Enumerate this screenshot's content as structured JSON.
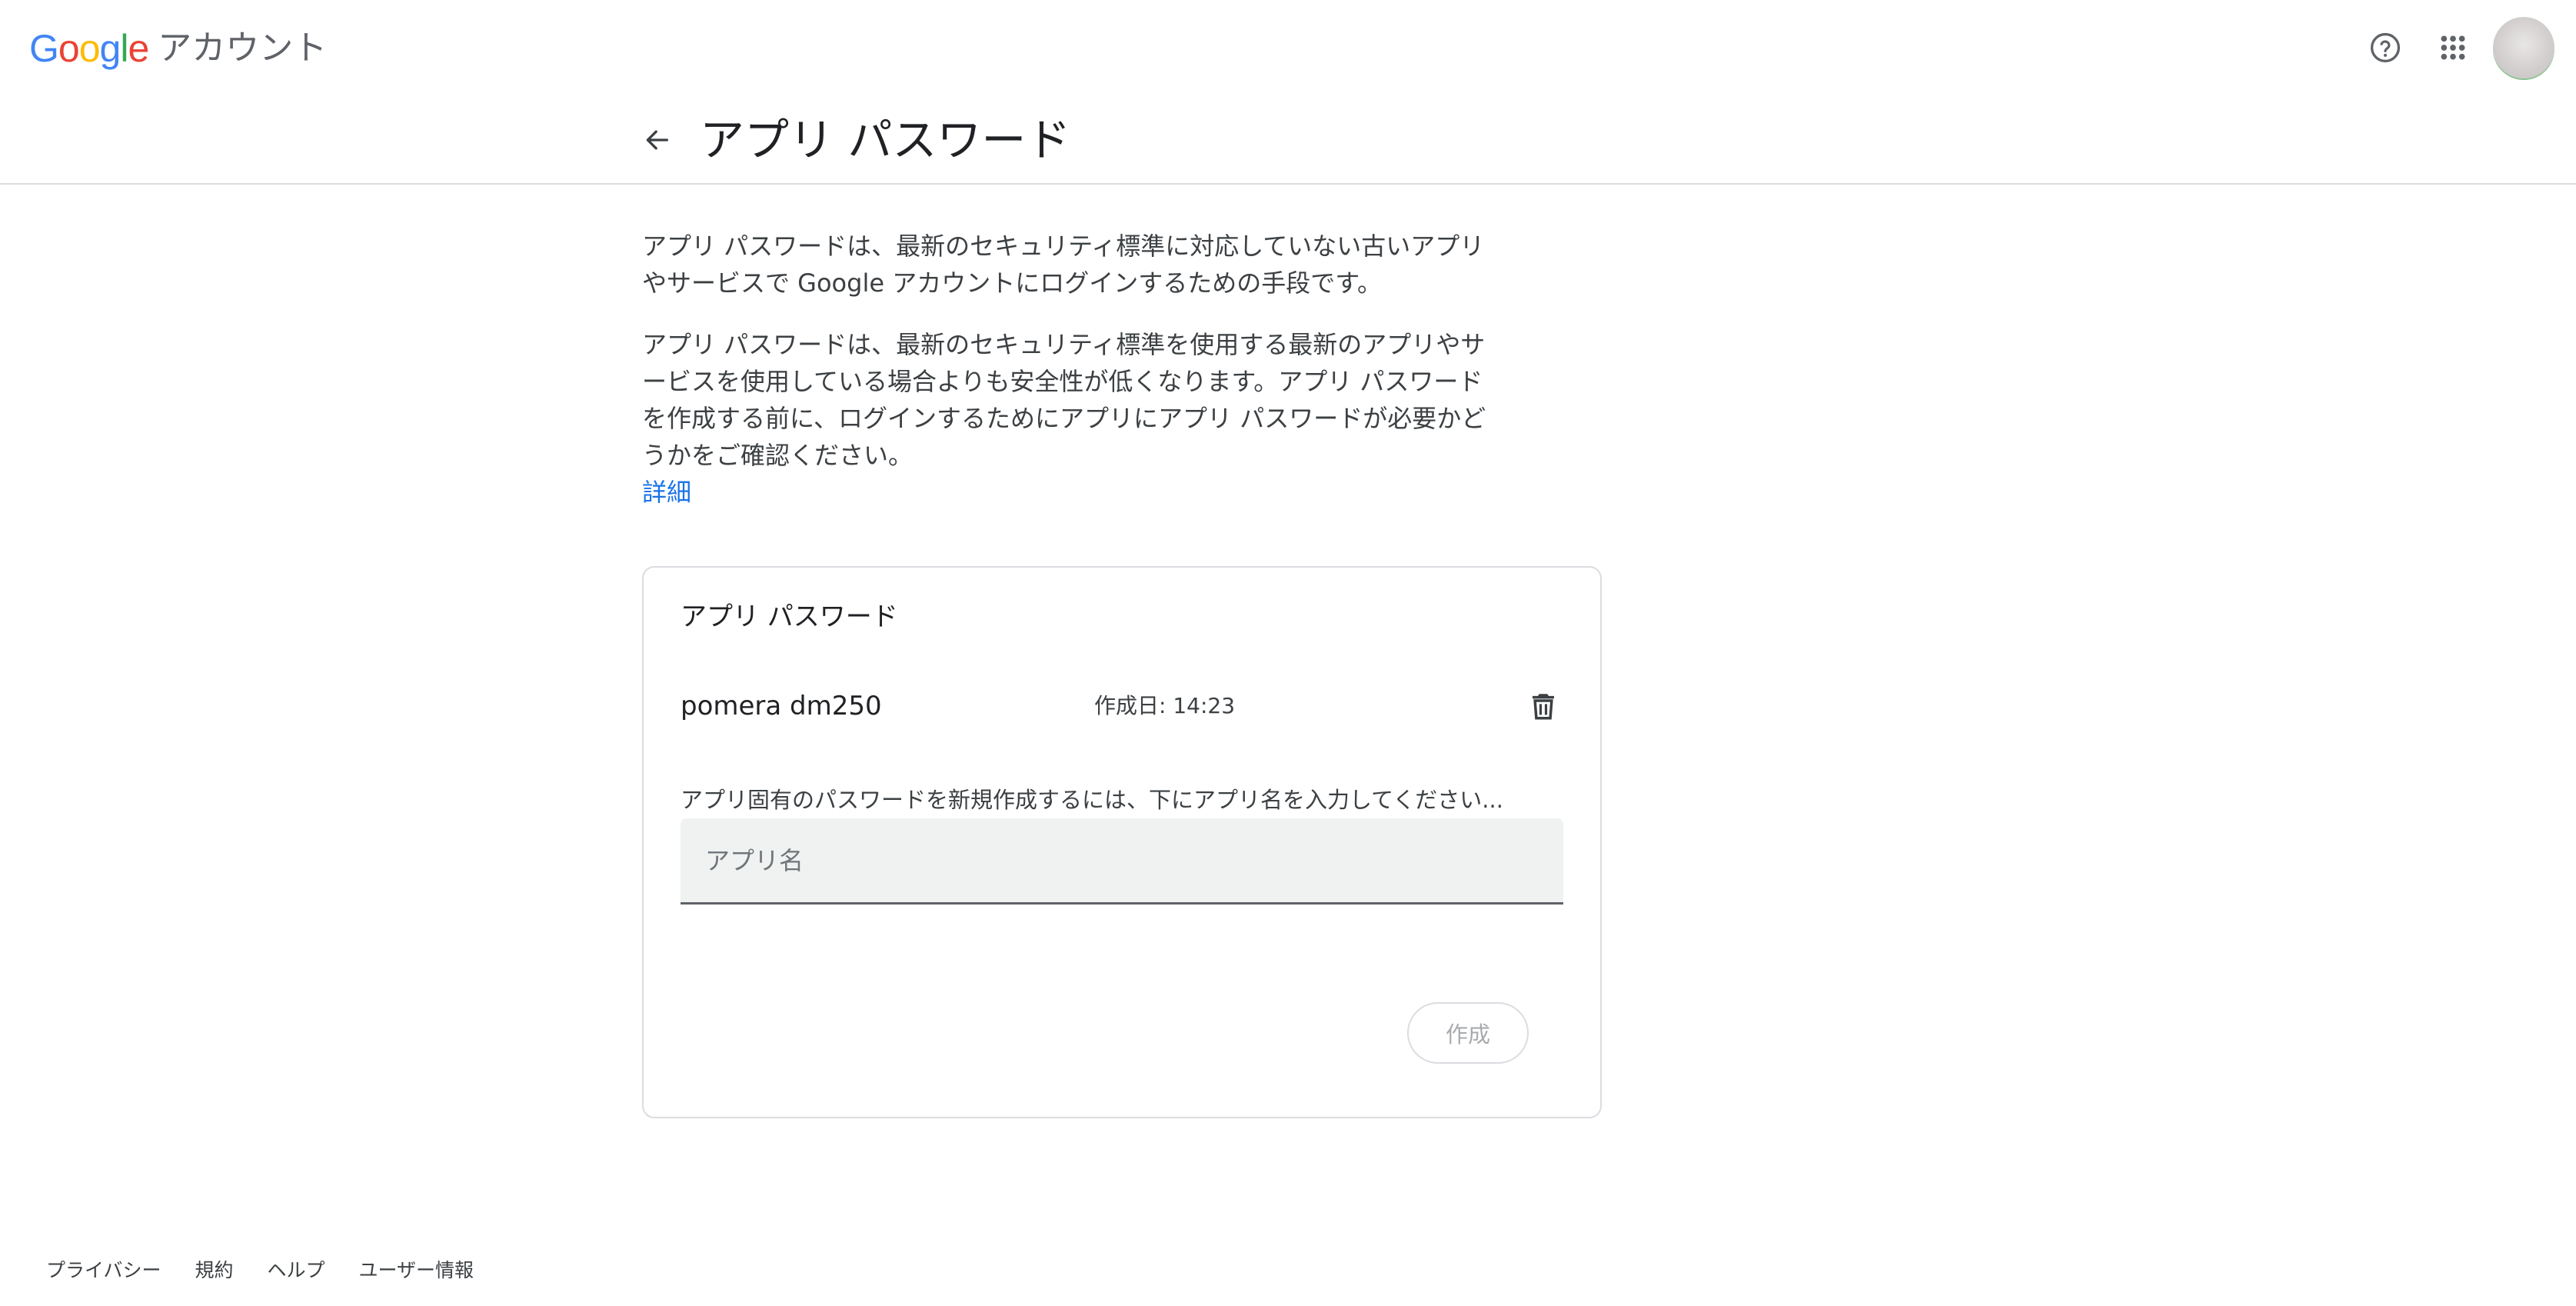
{
  "header": {
    "logo_parts": [
      "G",
      "o",
      "o",
      "g",
      "l",
      "e"
    ],
    "product": "アカウント",
    "help_icon": "help-circle-icon",
    "apps_icon": "apps-grid-icon",
    "avatar_icon": "account-avatar"
  },
  "page": {
    "back_icon": "arrow-back-icon",
    "title": "アプリ パスワード"
  },
  "description": {
    "paragraph1": "アプリ パスワードは、最新のセキュリティ標準に対応していない古いアプリやサービスで Google アカウントにログインするための手段です。",
    "paragraph2": "アプリ パスワードは、最新のセキュリティ標準を使用する最新のアプリやサービスを使用している場合よりも安全性が低くなります。アプリ パスワードを作成する前に、ログインするためにアプリにアプリ パスワードが必要かどうかをご確認ください。",
    "learn_more": "詳細"
  },
  "card": {
    "title": "アプリ パスワード",
    "passwords": [
      {
        "name": "pomera dm250",
        "created": "作成日: 14:23",
        "delete_icon": "trash-icon"
      }
    ],
    "helper_text": "アプリ固有のパスワードを新規作成するには、下にアプリ名を入力してください...",
    "input": {
      "value": "",
      "placeholder": "アプリ名"
    },
    "create_button": "作成"
  },
  "footer": {
    "links": [
      "プライバシー",
      "規約",
      "ヘルプ",
      "ユーザー情報"
    ]
  },
  "colors": {
    "link": "#1a73e8",
    "field_bg": "#eff2f1",
    "border": "#dadce0",
    "text_primary": "#202124",
    "text_secondary": "#3c4043"
  }
}
